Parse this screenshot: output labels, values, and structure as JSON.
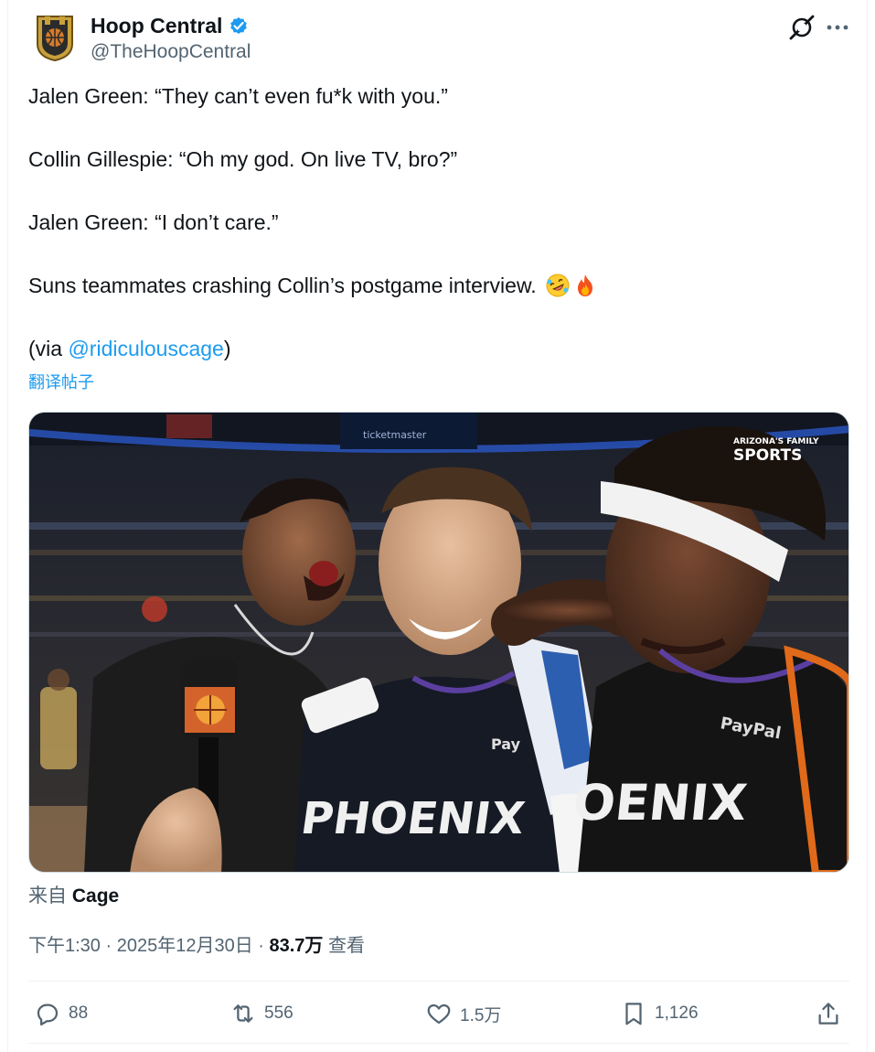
{
  "author": {
    "display_name": "Hoop Central",
    "handle": "@TheHoopCentral",
    "verified_icon": "verified-badge-icon"
  },
  "header_icons": {
    "grok": "grok-icon",
    "more": "more-icon"
  },
  "tweet": {
    "line1": "Jalen Green: “They can’t even fu*k with you.”",
    "line2": "Collin Gillespie: “Oh my god. On live TV, bro?”",
    "line3": "Jalen Green: “I don’t care.”",
    "line4": "Suns teammates crashing Collin’s postgame interview.",
    "emojis": [
      "rolling-laughing-emoji",
      "fire-emoji"
    ],
    "via_prefix": "(via ",
    "via_mention": "@ridiculouscage",
    "via_suffix": ")",
    "translate_label": "翻译帖子"
  },
  "media": {
    "watermark_line1": "ARIZONA'S FAMILY",
    "watermark_line2": "SPORTS",
    "jersey_text_left": "PHOENIX",
    "jersey_text_right": "OENIX",
    "sponsor_left": "Pay",
    "sponsor_right": "PayPal",
    "board_text": "ticketmaster"
  },
  "source": {
    "prefix": "来自 ",
    "name": "Cage"
  },
  "meta": {
    "time": "下午1:30",
    "sep1": " · ",
    "date": "2025年12月30日",
    "sep2": " · ",
    "views_count": "83.7万",
    "views_label": " 查看"
  },
  "actions": {
    "reply_count": "88",
    "retweet_count": "556",
    "like_count": "1.5万",
    "bookmark_count": "1,126"
  },
  "colors": {
    "accent": "#1d9bf0",
    "text": "#0f1419",
    "secondary": "#536471"
  }
}
